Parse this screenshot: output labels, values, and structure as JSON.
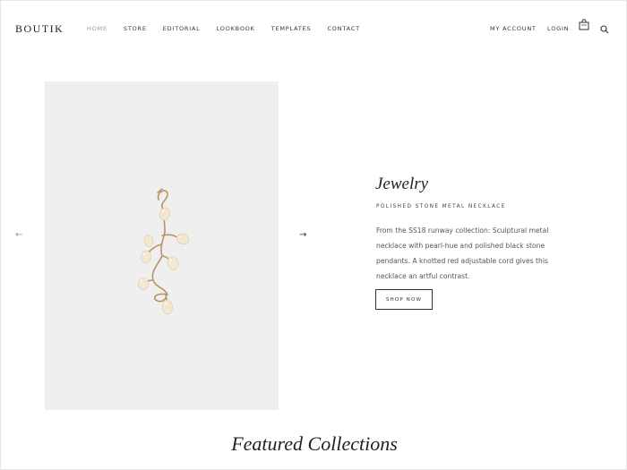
{
  "header": {
    "logo": "BOUTIK",
    "nav": [
      "HOME",
      "STORE",
      "EDITORIAL",
      "LOOKBOOK",
      "TEMPLATES",
      "CONTACT"
    ],
    "my_account": "MY ACCOUNT",
    "login": "LOGIN",
    "icons": [
      "cart-icon",
      "search-icon"
    ]
  },
  "hero": {
    "title": "Jewelry",
    "subtitle": "POLISHED STONE METAL NECKLACE",
    "description": "From the SS18 runway collection: Sculptural metal necklace with pearl-hue and polished black stone pendants. A knotted red adjustable cord gives this necklace an artful contrast.",
    "button": "SHOP NOW",
    "prev_arrow": "←",
    "next_arrow": "→"
  },
  "featured": {
    "title": "Featured Collections"
  },
  "colors": {
    "image_bg": "#efefef",
    "text": "#222222",
    "muted": "#999999",
    "gold": "#b8955f",
    "pearl": "#f3e7d2"
  }
}
